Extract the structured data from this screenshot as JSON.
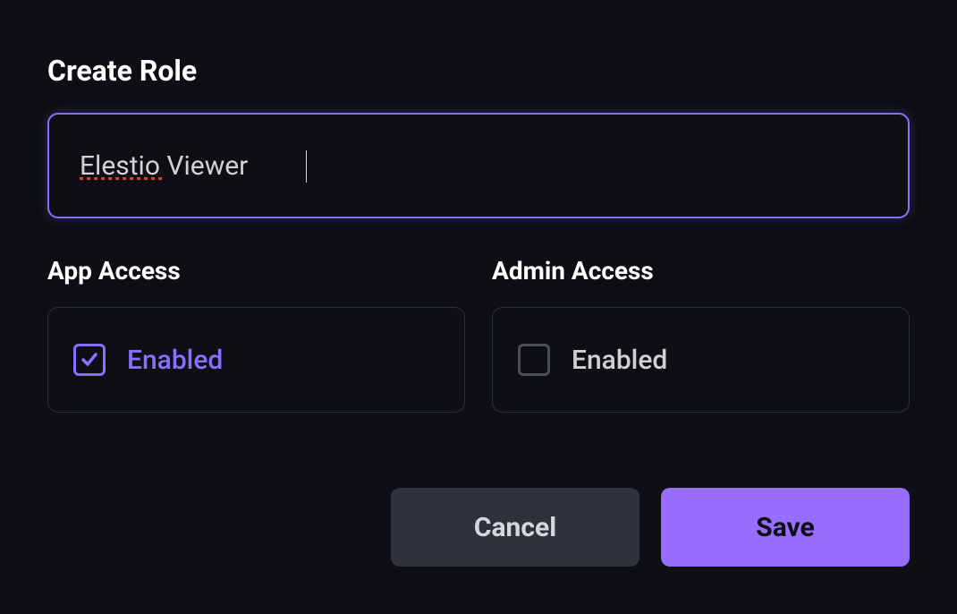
{
  "title": "Create Role",
  "roleName": "Elestio Viewer",
  "appAccess": {
    "label": "App Access",
    "checkLabel": "Enabled",
    "checked": true
  },
  "adminAccess": {
    "label": "Admin Access",
    "checkLabel": "Enabled",
    "checked": false
  },
  "buttons": {
    "cancel": "Cancel",
    "save": "Save"
  }
}
